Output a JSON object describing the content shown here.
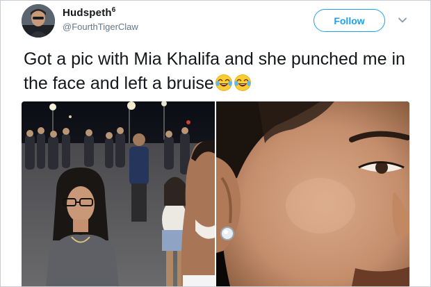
{
  "author": {
    "display_name": "Hudspeth",
    "display_name_suffix": "6",
    "handle": "@FourthTigerClaw",
    "avatar": "user-avatar"
  },
  "actions": {
    "follow_label": "Follow",
    "menu_icon": "chevron-down-icon"
  },
  "tweet": {
    "text": "Got a pic with Mia Khalifa and she punched me in the face and left a bruise",
    "emojis": [
      "face-with-tears-of-joy-emoji",
      "face-with-tears-of-joy-emoji"
    ]
  },
  "media": {
    "photos": [
      "selfie-photo",
      "cheek-closeup-photo"
    ]
  },
  "colors": {
    "accent": "#1da1f2",
    "text_primary": "#14171a",
    "text_secondary": "#657786"
  }
}
